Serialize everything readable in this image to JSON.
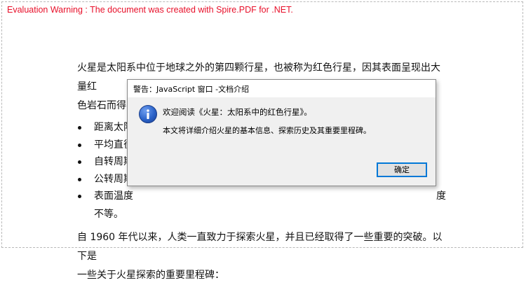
{
  "evaluation_warning": "Evaluation Warning : The document was created with Spire.PDF for .NET.",
  "colors": {
    "warning_text": "#e8102a",
    "dialog_border": "#8a8a8a",
    "button_focus": "#0078d7"
  },
  "document": {
    "paragraph1_line1": "火星是太阳系中位于地球之外的第四颗行星，也被称为红色行星，因其表面呈现出大量红",
    "paragraph1_line2": "色岩石而得名。",
    "bullets": [
      {
        "text": "距离太阳",
        "tail": ""
      },
      {
        "text": "平均直径",
        "tail": ""
      },
      {
        "text": "自转周期",
        "tail": ""
      },
      {
        "text": "公转周期",
        "tail": ""
      },
      {
        "text": "表面温度",
        "tail": "度"
      }
    ],
    "bullet5_continuation": "不等。",
    "paragraph2_line1": "自 1960 年代以来，人类一直致力于探索火星，并且已经取得了一些重要的突破。以下是",
    "paragraph2_line2": "一些关于火星探索的重要里程碑："
  },
  "dialog": {
    "title": "警告：JavaScript 窗口 -文档介绍",
    "icon": "info-icon",
    "message_line1": "欢迎阅读《火星：太阳系中的红色行星》。",
    "message_line2": "本文将详细介绍火星的基本信息、探索历史及其重要里程碑。",
    "ok_label": "确定"
  }
}
